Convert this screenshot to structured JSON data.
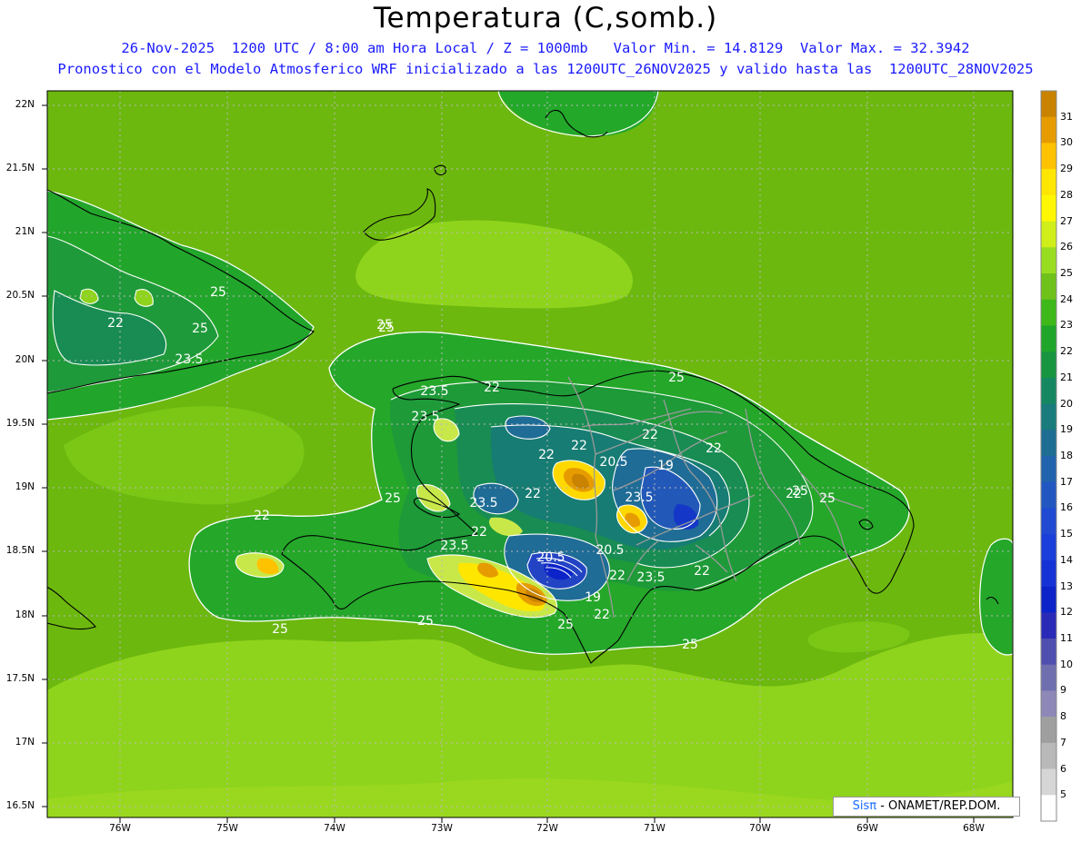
{
  "title": "Temperatura (C,somb.)",
  "subtitle_line1": "26-Nov-2025  1200 UTC / 8:00 am Hora Local / Z = 1000mb   Valor Min. = 14.8129  Valor Max. = 32.3942",
  "subtitle_line2": "Pronostico con el Modelo Atmosferico WRF inicializado a las 1200UTC_26NOV2025 y valido hasta las  1200UTC_28NOV2025",
  "latitude_labels": [
    "22N",
    "21.5N",
    "21N",
    "20.5N",
    "20N",
    "19.5N",
    "19N",
    "18.5N",
    "18N",
    "17.5N",
    "17N",
    "16.5N"
  ],
  "longitude_labels": [
    "76W",
    "75W",
    "74W",
    "73W",
    "72W",
    "71W",
    "70W",
    "69W",
    "68W"
  ],
  "colorbar": {
    "labels": [
      "31",
      "30",
      "29",
      "28",
      "27",
      "26",
      "25",
      "24",
      "23",
      "22",
      "21",
      "20",
      "19",
      "18",
      "17",
      "16",
      "15",
      "14",
      "13",
      "12",
      "11",
      "10",
      "9",
      "8",
      "7",
      "6",
      "5"
    ],
    "colors": [
      "#c98300",
      "#e69c00",
      "#ffc200",
      "#ffe600",
      "#fff700",
      "#cfee1a",
      "#99dd22",
      "#6fc21a",
      "#3fb81a",
      "#1fa62a",
      "#17953f",
      "#168861",
      "#197b7b",
      "#1e6e94",
      "#2263ad",
      "#2257c2",
      "#1f4ad1",
      "#1a3ed9",
      "#1432d6",
      "#0b23c9",
      "#2a2ab8",
      "#4f4fb0",
      "#6f6fb0",
      "#8e88b8",
      "#9f9f9f",
      "#b9b9b9",
      "#d6d6d6",
      "#ffffff"
    ]
  },
  "contour_labels": [
    "25",
    "22",
    "25",
    "23.5",
    "25",
    "23.5",
    "22",
    "23.5",
    "25",
    "23.5",
    "22",
    "22",
    "22",
    "22",
    "25",
    "22",
    "22",
    "20.5",
    "19",
    "23.5",
    "25",
    "22",
    "22",
    "20.5",
    "20.5",
    "23.5",
    "22",
    "19",
    "22",
    "23.5",
    "22",
    "25",
    "25",
    "25",
    "25",
    "25",
    "25"
  ],
  "credit": {
    "sis": "Sisπ",
    "org": " - ONAMET/REP.DOM."
  }
}
